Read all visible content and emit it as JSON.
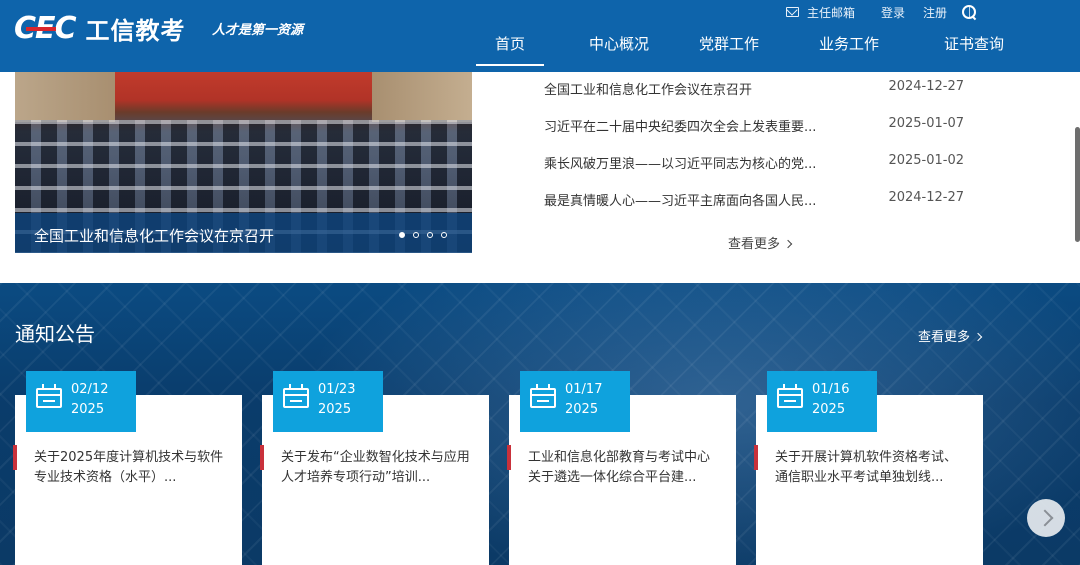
{
  "header": {
    "logo_mark": "CEC",
    "logo_name": "工信教考",
    "slogan": "人才是第一资源",
    "top_links": {
      "mailbox": "主任邮箱",
      "login": "登录",
      "register": "注册"
    },
    "nav": [
      "首页",
      "中心概况",
      "党群工作",
      "业务工作",
      "证书查询"
    ],
    "active_nav": "首页"
  },
  "banner": {
    "caption": "全国工业和信息化工作会议在京召开",
    "slide_count": 4,
    "active_slide": 1
  },
  "news": [
    {
      "title": "全国工业和信息化工作会议在京召开",
      "date": "2024-12-27"
    },
    {
      "title": "习近平在二十届中央纪委四次全会上发表重要...",
      "date": "2025-01-07"
    },
    {
      "title": "乘长风破万里浪——以习近平同志为核心的党...",
      "date": "2025-01-02"
    },
    {
      "title": "最是真情暖人心——习近平主席面向各国人民...",
      "date": "2024-12-27"
    }
  ],
  "news_more": "查看更多",
  "notice": {
    "title": "通知公告",
    "more": "查看更多",
    "cards": [
      {
        "md": "02/12",
        "year": "2025",
        "line1": "关于2025年度计算机技术与软件",
        "line2": "专业技术资格（水平）..."
      },
      {
        "md": "01/23",
        "year": "2025",
        "line1": "关于发布“企业数智化技术与应用",
        "line2": "人才培养专项行动”培训..."
      },
      {
        "md": "01/17",
        "year": "2025",
        "line1": "工业和信息化部教育与考试中心",
        "line2": "关于遴选一体化综合平台建..."
      },
      {
        "md": "01/16",
        "year": "2025",
        "line1": "关于开展计算机软件资格考试、",
        "line2": "通信职业水平考试单独划线..."
      }
    ]
  },
  "colors": {
    "brand_blue": "#0e64ab",
    "card_date": "#0fa2dd",
    "accent_red": "#c9313b"
  }
}
